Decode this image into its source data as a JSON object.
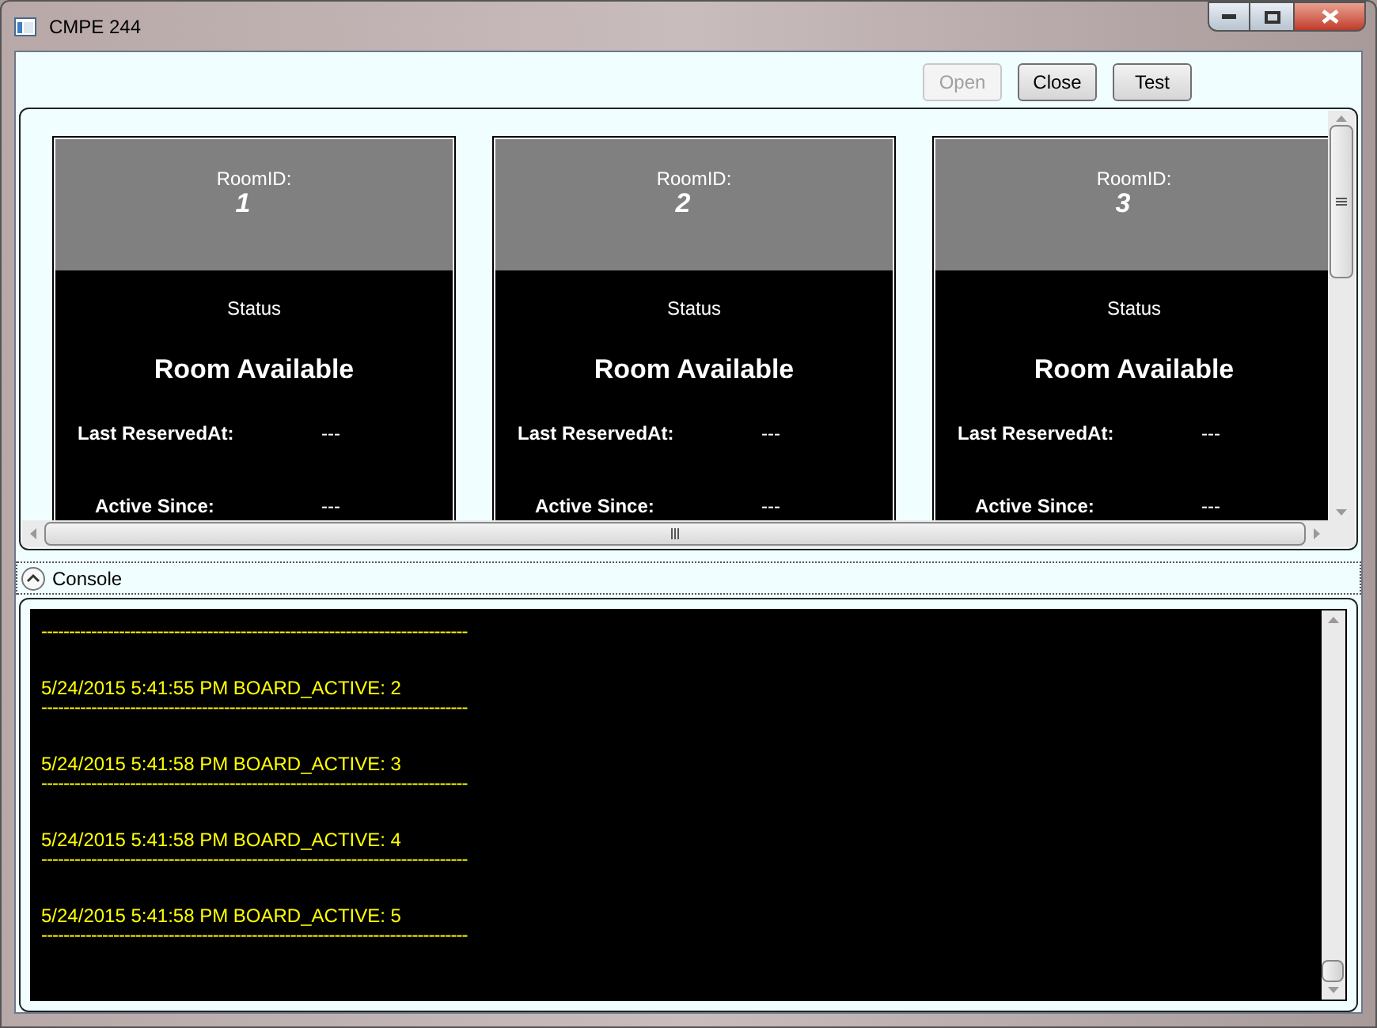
{
  "window": {
    "title": "CMPE 244"
  },
  "toolbar": {
    "buttons": [
      {
        "label": "Open",
        "disabled": true
      },
      {
        "label": "Close",
        "disabled": false
      },
      {
        "label": "Test",
        "disabled": false
      }
    ]
  },
  "rooms": [
    {
      "id_label": "RoomID:",
      "id": "1",
      "status_label": "Status",
      "status": "Room Available",
      "fields": [
        {
          "label": "Last ReservedAt:",
          "value": "---"
        },
        {
          "label": "Active Since:",
          "value": "---"
        }
      ]
    },
    {
      "id_label": "RoomID:",
      "id": "2",
      "status_label": "Status",
      "status": "Room Available",
      "fields": [
        {
          "label": "Last ReservedAt:",
          "value": "---"
        },
        {
          "label": "Active Since:",
          "value": "---"
        }
      ]
    },
    {
      "id_label": "RoomID:",
      "id": "3",
      "status_label": "Status",
      "status": "Room Available",
      "fields": [
        {
          "label": "Last ReservedAt:",
          "value": "---"
        },
        {
          "label": "Active Since:",
          "value": "---"
        }
      ]
    }
  ],
  "console": {
    "header": "Console",
    "expanded": true,
    "log": [
      {
        "kind": "separator",
        "text": "-----------------------------------------------------------------------------"
      },
      {
        "kind": "message",
        "text": "5/24/2015 5:41:55 PM BOARD_ACTIVE: 2"
      },
      {
        "kind": "separator",
        "text": "-----------------------------------------------------------------------------"
      },
      {
        "kind": "message",
        "text": "5/24/2015 5:41:58 PM BOARD_ACTIVE: 3"
      },
      {
        "kind": "separator",
        "text": "-----------------------------------------------------------------------------"
      },
      {
        "kind": "message",
        "text": "5/24/2015 5:41:58 PM BOARD_ACTIVE: 4"
      },
      {
        "kind": "separator",
        "text": "-----------------------------------------------------------------------------"
      },
      {
        "kind": "message",
        "text": "5/24/2015 5:41:58 PM BOARD_ACTIVE: 5"
      },
      {
        "kind": "separator",
        "text": "-----------------------------------------------------------------------------"
      }
    ]
  }
}
